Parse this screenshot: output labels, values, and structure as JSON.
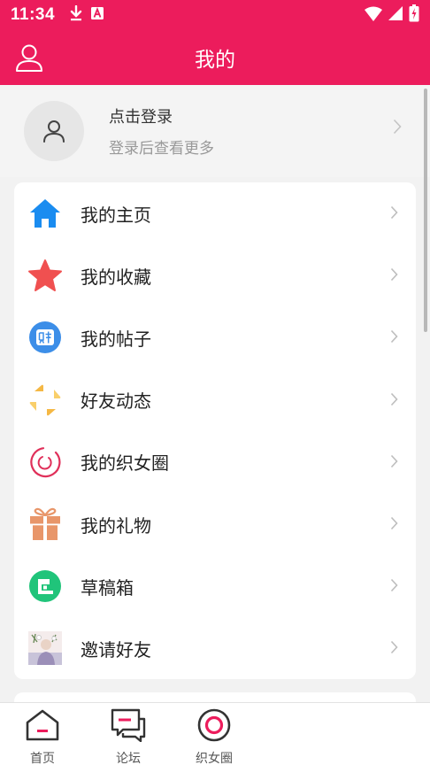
{
  "status_bar": {
    "time": "11:34",
    "left_icons": [
      "download-icon",
      "a-badge-icon"
    ],
    "right_icons": [
      "wifi-icon",
      "signal-icon",
      "battery-charging-icon"
    ]
  },
  "app_bar": {
    "title": "我的",
    "left_icon": "user-outline-icon",
    "background": "#ec1c5c"
  },
  "login": {
    "title": "点击登录",
    "subtitle": "登录后查看更多"
  },
  "menu": {
    "items": [
      {
        "label": "我的主页",
        "icon": "home-icon",
        "color": "#1a8cf0"
      },
      {
        "label": "我的收藏",
        "icon": "star-icon",
        "color": "#f05050"
      },
      {
        "label": "我的帖子",
        "icon": "post-tag-icon",
        "color": "#3c8ee8"
      },
      {
        "label": "好友动态",
        "icon": "pinwheel-icon",
        "color": "#f5b844"
      },
      {
        "label": "我的织女圈",
        "icon": "circle-ring-icon",
        "color": "#e0305a"
      },
      {
        "label": "我的礼物",
        "icon": "gift-icon",
        "color": "#e8966a"
      },
      {
        "label": "草稿箱",
        "icon": "draft-box-icon",
        "color": "#20c47a"
      },
      {
        "label": "邀请好友",
        "icon": "invite-photo-icon",
        "color": "#9b8fb8"
      }
    ]
  },
  "bottom_nav": {
    "tabs": [
      {
        "label": "首页",
        "icon": "house-icon"
      },
      {
        "label": "论坛",
        "icon": "forum-chat-icon"
      },
      {
        "label": "织女圈",
        "icon": "target-circle-icon",
        "accent": "#ec1c5c"
      }
    ]
  }
}
